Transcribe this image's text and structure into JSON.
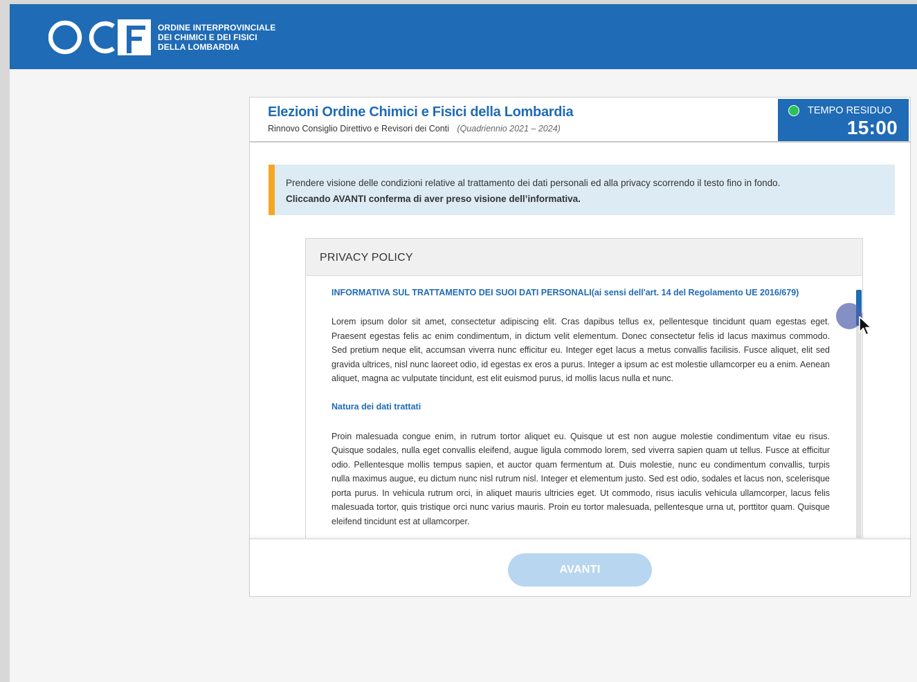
{
  "brand": {
    "logo_letters": "OCF",
    "lines": [
      "ORDINE INTERPROVINCIALE",
      "DEI CHIMICI E DEI FISICI",
      "DELLA LOMBARDIA"
    ]
  },
  "election": {
    "title": "Elezioni Ordine Chimici e Fisici della Lombardia",
    "subtitle": "Rinnovo Consiglio Direttivo e Revisori dei Conti",
    "period": "(Quadriennio 2021 – 2024)"
  },
  "timer": {
    "label": "TEMPO RESIDUO",
    "value": "15:00",
    "status_color": "#2ec15a"
  },
  "notice": {
    "line1": "Prendere visione delle condizioni relative al trattamento dei dati personali ed alla privacy scorrendo il testo fino in fondo.",
    "line2": "Cliccando AVANTI conferma di aver preso visione dell’informativa.",
    "accent_color": "#f5a623"
  },
  "privacy": {
    "title": "PRIVACY POLICY",
    "heading1": "INFORMATIVA SUL TRATTAMENTO DEI SUOI DATI PERSONALI(ai sensi dell'art. 14 del Regolamento UE 2016/679)",
    "paragraph1": "Lorem ipsum dolor sit amet, consectetur adipiscing elit. Cras dapibus tellus ex, pellentesque tincidunt quam egestas eget. Praesent egestas felis ac enim condimentum, in dictum velit elementum. Donec consectetur felis id lacus maximus commodo. Sed pretium neque elit, accumsan viverra nunc efficitur eu. Integer eget lacus a metus convallis facilisis. Fusce aliquet, elit sed gravida ultrices, nisl nunc laoreet odio, id egestas ex eros a purus. Integer a ipsum ac est molestie ullamcorper eu a enim. Aenean aliquet, magna ac vulputate tincidunt, est elit euismod purus, id mollis lacus nulla et nunc.",
    "heading2": "Natura dei dati trattati",
    "paragraph2": "Proin malesuada congue enim, in rutrum tortor aliquet eu. Quisque ut est non augue molestie condimentum vitae eu risus. Quisque sodales, nulla eget convallis eleifend, augue ligula commodo lorem, sed viverra sapien quam ut tellus. Fusce at efficitur odio. Pellentesque mollis tempus sapien, et auctor quam fermentum at. Duis molestie, nunc eu condimentum convallis, turpis nulla maximus augue, eu dictum nunc nisl rutrum nisl. Integer et elementum justo. Sed est odio, sodales et lacus non, scelerisque porta purus. In vehicula rutrum orci, in aliquet mauris ultricies eget. Ut commodo, risus iaculis vehicula ullamcorper, lacus felis malesuada tortor, quis tristique orci nunc varius mauris. Proin eu tortor malesuada, pellentesque urna ut, porttitor quam. Quisque eleifend tincidunt est at ullamcorper."
  },
  "actions": {
    "next_label": "AVANTI"
  },
  "colors": {
    "brand_blue": "#1f6bb5",
    "disabled_button": "#b8d6ef"
  }
}
